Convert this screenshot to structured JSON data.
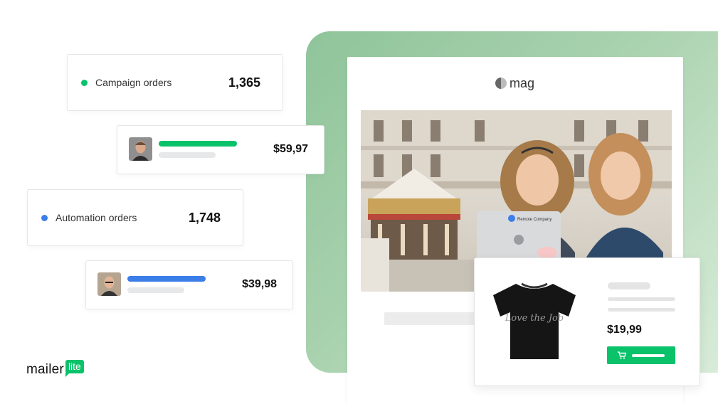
{
  "stats": {
    "campaign": {
      "label": "Campaign orders",
      "value": "1,365",
      "dot_color": "#09c269"
    },
    "automation": {
      "label": "Automation orders",
      "value": "1,748",
      "dot_color": "#3b7ee8"
    }
  },
  "orders": [
    {
      "price": "$59,97",
      "bar_color": "#09c269"
    },
    {
      "price": "$39,98",
      "bar_color": "#3b7ee8"
    }
  ],
  "email": {
    "logo_text": "mag",
    "laptop_sticker": "Remote Company"
  },
  "product": {
    "price": "$19,99",
    "shirt_print": "Love the Job",
    "cart_icon": "cart-icon"
  },
  "brand": {
    "word": "mailer",
    "badge": "lite"
  },
  "colors": {
    "accent_green": "#09c269",
    "accent_blue": "#3b7ee8"
  }
}
